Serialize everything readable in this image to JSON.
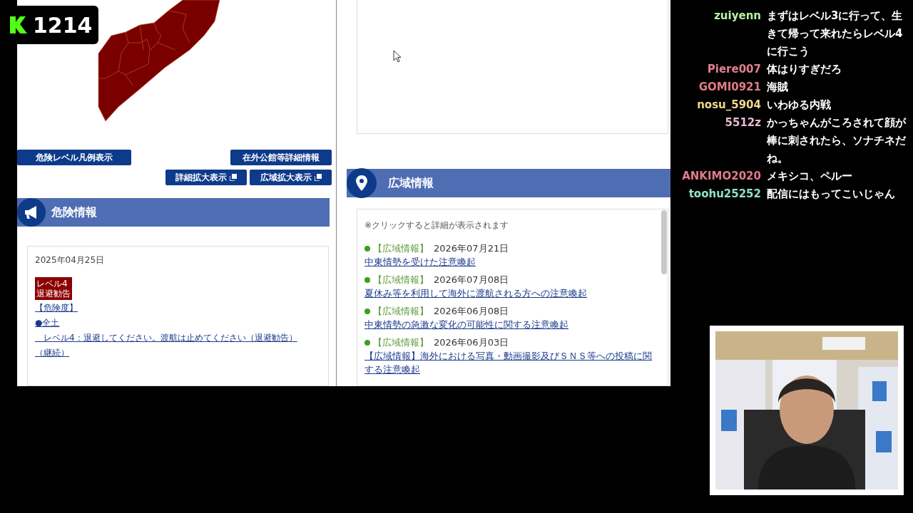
{
  "viewer_count": {
    "value": "1214"
  },
  "map_buttons": [
    {
      "label": "危険レベル凡例表示",
      "kind": "plain"
    },
    {
      "label": "在外公館等詳細情報",
      "kind": "plain"
    },
    {
      "label": "詳細拡大表示",
      "kind": "external"
    },
    {
      "label": "広域拡大表示",
      "kind": "external"
    }
  ],
  "danger_section": {
    "title": "危険情報",
    "date": "2025年04月25日",
    "level_badge": [
      "レベル4",
      "退避勧告"
    ],
    "links": [
      "【危険度】",
      "●全土",
      "　レベル4：退避してください。渡航は止めてください（退避勧告）",
      "（継続）"
    ]
  },
  "wide_area_section": {
    "title": "広域情報",
    "note": "※クリックすると詳細が表示されます",
    "items": [
      {
        "tag": "【広域情報】",
        "date": "2026年07月21日",
        "title": "中東情勢を受けた注意喚起"
      },
      {
        "tag": "【広域情報】",
        "date": "2026年07月08日",
        "title": "夏休み等を利用して海外に渡航される方への注意喚起"
      },
      {
        "tag": "【広域情報】",
        "date": "2026年06月08日",
        "title": "中東情勢の急激な変化の可能性に関する注意喚起"
      },
      {
        "tag": "【広域情報】",
        "date": "2026年06月03日",
        "title": "【広域情報】海外における写真・動画撮影及びＳＮＳ等への投稿に関する注意喚起"
      }
    ]
  },
  "chat": [
    {
      "user": "zuiyenn",
      "color": "#b9f0a8",
      "message": "まずはレベル3に行って、生きて帰って来れたらレベル4に行こう"
    },
    {
      "user": "Piere007",
      "color": "#e0808e",
      "message": "体はりすぎだろ"
    },
    {
      "user": "GOMI0921",
      "color": "#e07a8a",
      "message": "海賊"
    },
    {
      "user": "nosu_5904",
      "color": "#f0d890",
      "message": "いわゆる内戦"
    },
    {
      "user": "5512z",
      "color": "#e8b8d0",
      "message": "かっちゃんがころされて顔が棒に刺されたら、ソナチネだね。"
    },
    {
      "user": "ANKIMO2020",
      "color": "#e07a8a",
      "message": "メキシコ、ペルー"
    },
    {
      "user": "toohu25252",
      "color": "#90e0c8",
      "message": "配信にはもってこいじゃん"
    }
  ]
}
